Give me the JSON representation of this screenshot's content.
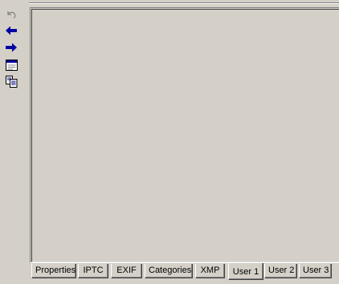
{
  "toolbar": {
    "icons": [
      "undo-icon",
      "back-arrow-icon",
      "forward-arrow-icon",
      "window-icon",
      "copy-icon"
    ],
    "colors": {
      "arrow": "#0000a0",
      "disabled": "#808080"
    }
  },
  "tabs": [
    {
      "label": "Properties"
    },
    {
      "label": "IPTC"
    },
    {
      "label": "EXIF"
    },
    {
      "label": "Categories"
    },
    {
      "label": "XMP"
    },
    {
      "label": "User 1",
      "active": true
    },
    {
      "label": "User 2"
    },
    {
      "label": "User 3"
    }
  ]
}
